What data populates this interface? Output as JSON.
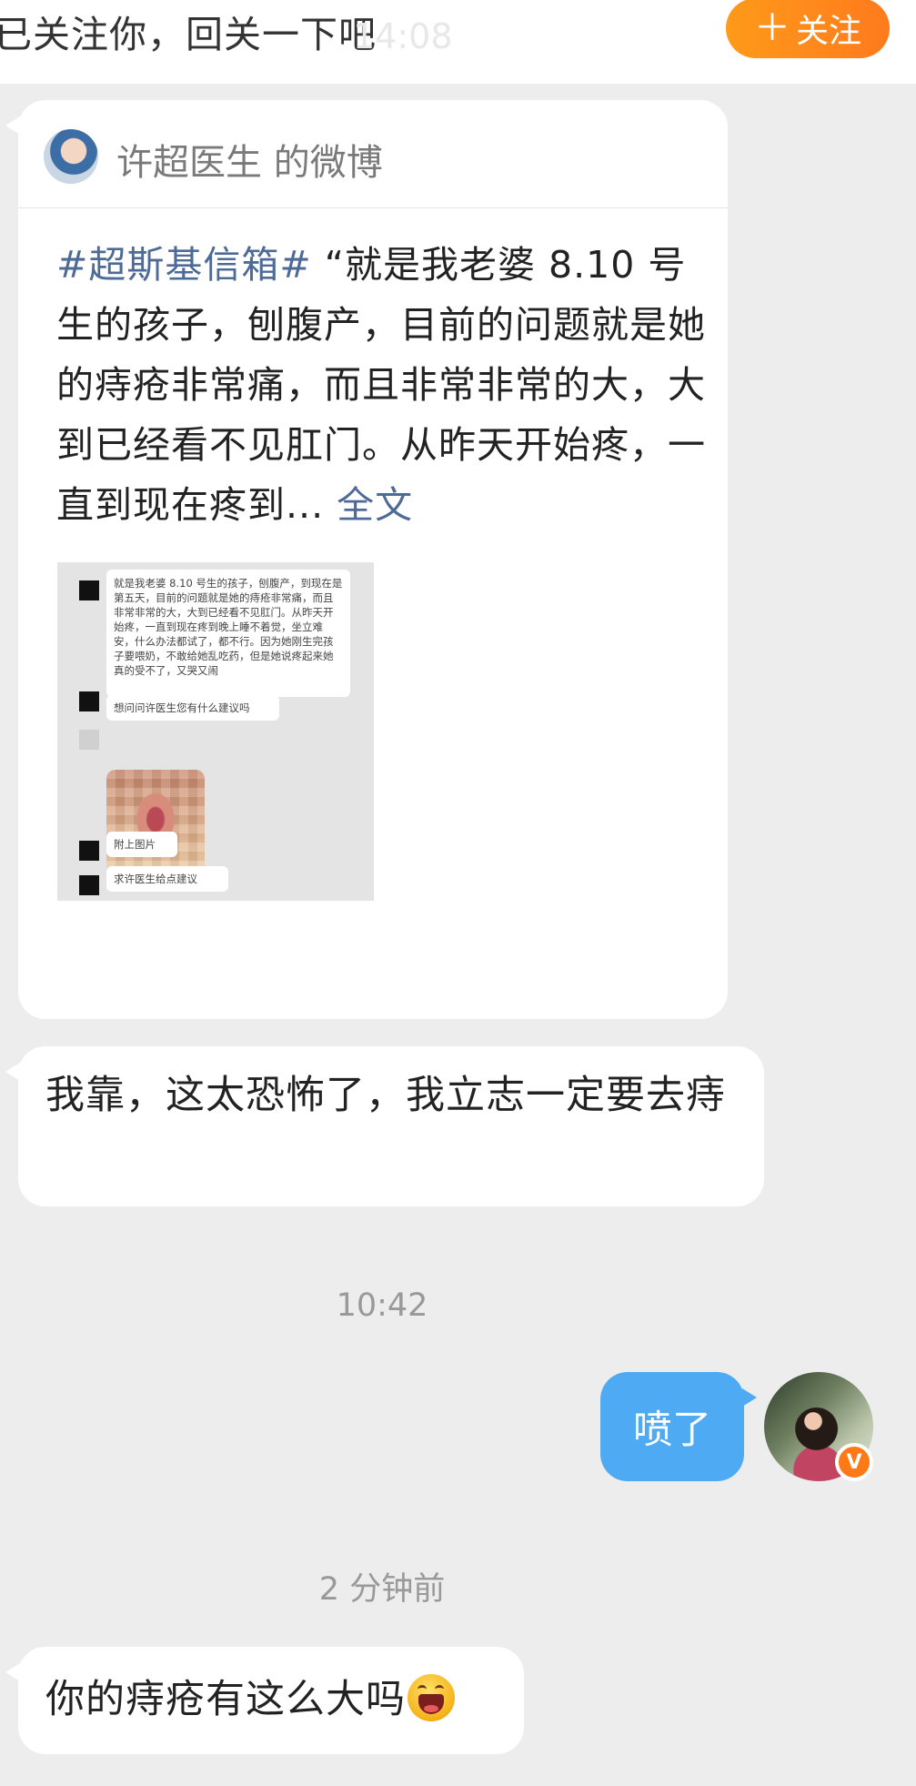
{
  "top_banner": {
    "text": "已关注你，回关一下吧",
    "faded_time": "14:08",
    "follow_button": "关注",
    "follow_plus": "＋"
  },
  "weibo_card": {
    "author_line": "许超医生 的微博",
    "hashtag": "#超斯基信箱#",
    "body": "“就是我老婆 8.10 号生的孩子，刨腹产，目前的问题就是她的痔疮非常痛，而且非常非常的大，大到已经看不见肛门。从昨天开始疼，一直到现在疼到...",
    "full_text_link": "全文",
    "screenshot": {
      "msg1": "就是我老婆 8.10 号生的孩子，刨腹产，到现在是第五天，目前的问题就是她的痔疮非常痛，而且非常非常的大，大到已经看不见肛门。从昨天开始疼，一直到现在疼到晚上睡不着觉，坐立难安，什么办法都试了，都不行。因为她刚生完孩子要喂奶，不敢给她乱吃药，但是她说疼起来她真的受不了，又哭又闹",
      "msg2": "想问问许医生您有什么建议吗",
      "msg3": "附上图片",
      "msg4": "求许医生给点建议"
    }
  },
  "messages": {
    "received1": "我靠，这太恐怖了，我立志一定要去痔",
    "time1": "10:42",
    "sent1": "喷了",
    "time2": "2 分钟前",
    "received2": "你的痔疮有这么大吗"
  },
  "badge": {
    "letter": "V",
    "color": "#ff7a16"
  },
  "colors": {
    "accent_blue": "#4faaf4",
    "follow_orange": "#ff8a1a",
    "link": "#4e6b97"
  }
}
